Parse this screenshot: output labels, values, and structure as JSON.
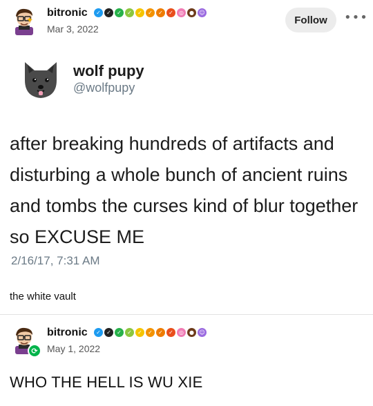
{
  "post1": {
    "username": "bitronic",
    "date": "Mar 3, 2022",
    "follow_label": "Follow",
    "more_label": "•••",
    "sparkle": "✦"
  },
  "quoted_tweet": {
    "name": "wolf pupy",
    "handle": "@wolfpupy",
    "body": "after breaking hundreds of artifacts and disturbing a whole bunch of ancient ruins and tombs the curses kind of blur together so EXCUSE ME",
    "timestamp": "2/16/17, 7:31 AM"
  },
  "caption": "the white vault",
  "post2": {
    "username": "bitronic",
    "date": "May 1, 2022",
    "reblog_glyph": "⟳",
    "body": "WHO THE HELL IS WU XIE"
  },
  "badges": [
    {
      "name": "verified-blue-badge",
      "color": "#1d9bf0",
      "glyph": "✓"
    },
    {
      "name": "verified-black-badge",
      "color": "#222222",
      "glyph": "✓"
    },
    {
      "name": "verified-green-badge",
      "color": "#27b14a",
      "glyph": "✓"
    },
    {
      "name": "verified-lime-badge",
      "color": "#8cc63f",
      "glyph": "✓"
    },
    {
      "name": "verified-yellow-badge",
      "color": "#f5c400",
      "glyph": "✓"
    },
    {
      "name": "verified-orange-badge",
      "color": "#f39200",
      "glyph": "✓"
    },
    {
      "name": "verified-orange2-badge",
      "color": "#ee7b00",
      "glyph": "✓"
    },
    {
      "name": "verified-red-badge",
      "color": "#e94e1b",
      "glyph": "✓"
    },
    {
      "name": "spiral-badge",
      "color": "#f07bb4",
      "glyph": "◎"
    },
    {
      "name": "paw-badge",
      "color": "#6d3b1b",
      "glyph": "●"
    },
    {
      "name": "ghost-badge",
      "color": "#9b6be0",
      "glyph": "☺"
    }
  ],
  "colors": {
    "follow_bg": "#ececec",
    "muted_text": "#6b7a86",
    "reblog_green": "#00b34a"
  }
}
